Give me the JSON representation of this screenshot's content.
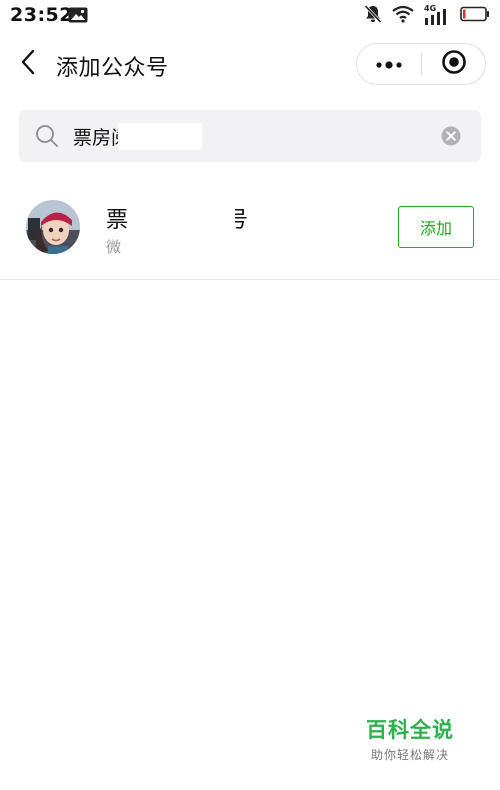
{
  "status_bar": {
    "time": "23:52",
    "icons": [
      "gallery-icon",
      "mute-bell-icon",
      "wifi-icon",
      "signal-4g-icon",
      "battery-icon"
    ],
    "network_label": "4G"
  },
  "header": {
    "title": "添加公众号",
    "back_icon": "chevron-left-icon",
    "more_icon": "more-dots-icon",
    "close_icon": "target-close-icon"
  },
  "search": {
    "value": "票房阅号",
    "visible_prefix": "票",
    "visible_suffix": "阅号",
    "clear_icon": "clear-circle-icon"
  },
  "results": [
    {
      "name_prefix": "票",
      "name_suffix": "号",
      "sub_prefix": "微",
      "add_label": "添加"
    }
  ],
  "watermark": {
    "title": "百科全说",
    "subtitle": "助你轻松解决"
  },
  "colors": {
    "accent_green": "#1aad19",
    "watermark_green": "#2bb24c",
    "search_bg": "#f2f2f4",
    "secondary_text": "#9a9a9a"
  }
}
